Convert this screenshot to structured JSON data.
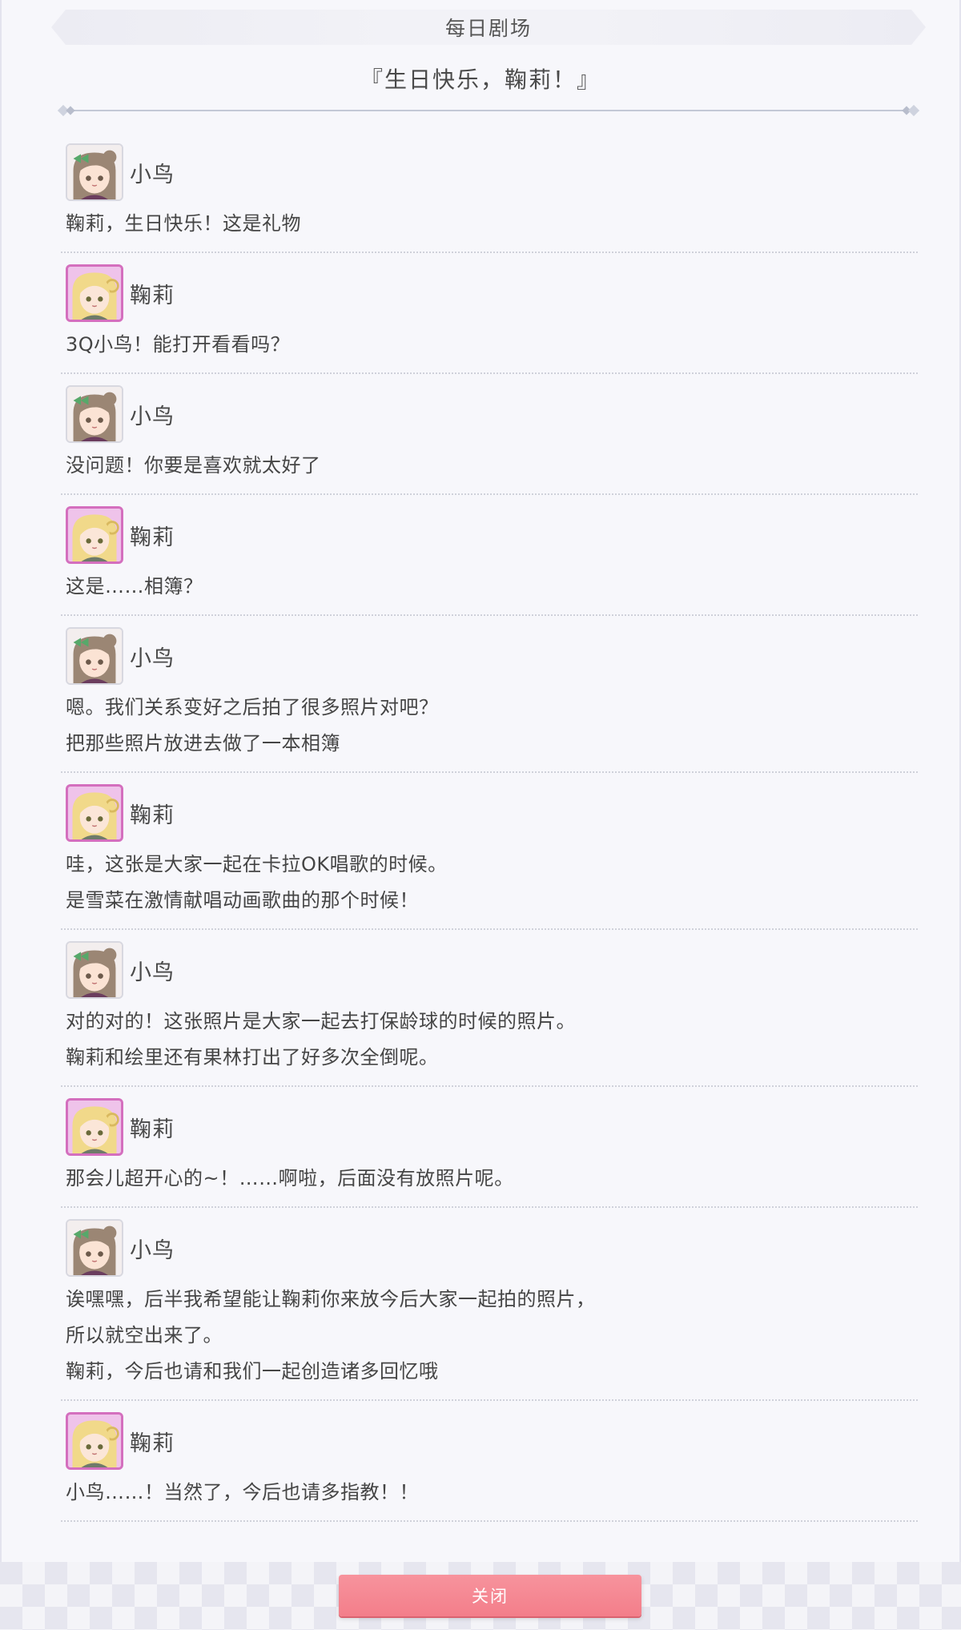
{
  "header": {
    "title": "每日剧场"
  },
  "episode": {
    "title": "『生日快乐，鞠莉！』"
  },
  "close_button": {
    "label": "关闭"
  },
  "speakers": {
    "kotori": {
      "name": "小鸟",
      "avatar_icon": "kotori-avatar-icon",
      "frame_color": "#d8d8e0"
    },
    "mari": {
      "name": "鞠莉",
      "avatar_icon": "mari-avatar-icon",
      "frame_color": "#d46fbe"
    }
  },
  "dialogue": [
    {
      "speaker": "小鸟",
      "lines": [
        "鞠莉，生日快乐！这是礼物"
      ]
    },
    {
      "speaker": "鞠莉",
      "lines": [
        "3Q小鸟！能打开看看吗？"
      ]
    },
    {
      "speaker": "小鸟",
      "lines": [
        "没问题！你要是喜欢就太好了"
      ]
    },
    {
      "speaker": "鞠莉",
      "lines": [
        "这是……相簿？"
      ]
    },
    {
      "speaker": "小鸟",
      "lines": [
        "嗯。我们关系变好之后拍了很多照片对吧？",
        "把那些照片放进去做了一本相簿"
      ]
    },
    {
      "speaker": "鞠莉",
      "lines": [
        "哇，这张是大家一起在卡拉OK唱歌的时候。",
        "是雪菜在激情献唱动画歌曲的那个时候！"
      ]
    },
    {
      "speaker": "小鸟",
      "lines": [
        "对的对的！这张照片是大家一起去打保龄球的时候的照片。",
        "鞠莉和绘里还有果林打出了好多次全倒呢。"
      ]
    },
    {
      "speaker": "鞠莉",
      "lines": [
        "那会儿超开心的~！……啊啦，后面没有放照片呢。"
      ]
    },
    {
      "speaker": "小鸟",
      "lines": [
        "诶嘿嘿，后半我希望能让鞠莉你来放今后大家一起拍的照片，",
        "所以就空出来了。",
        "鞠莉，今后也请和我们一起创造诸多回忆哦"
      ]
    },
    {
      "speaker": "鞠莉",
      "lines": [
        "小鸟……！当然了，今后也请多指教！！"
      ]
    }
  ]
}
